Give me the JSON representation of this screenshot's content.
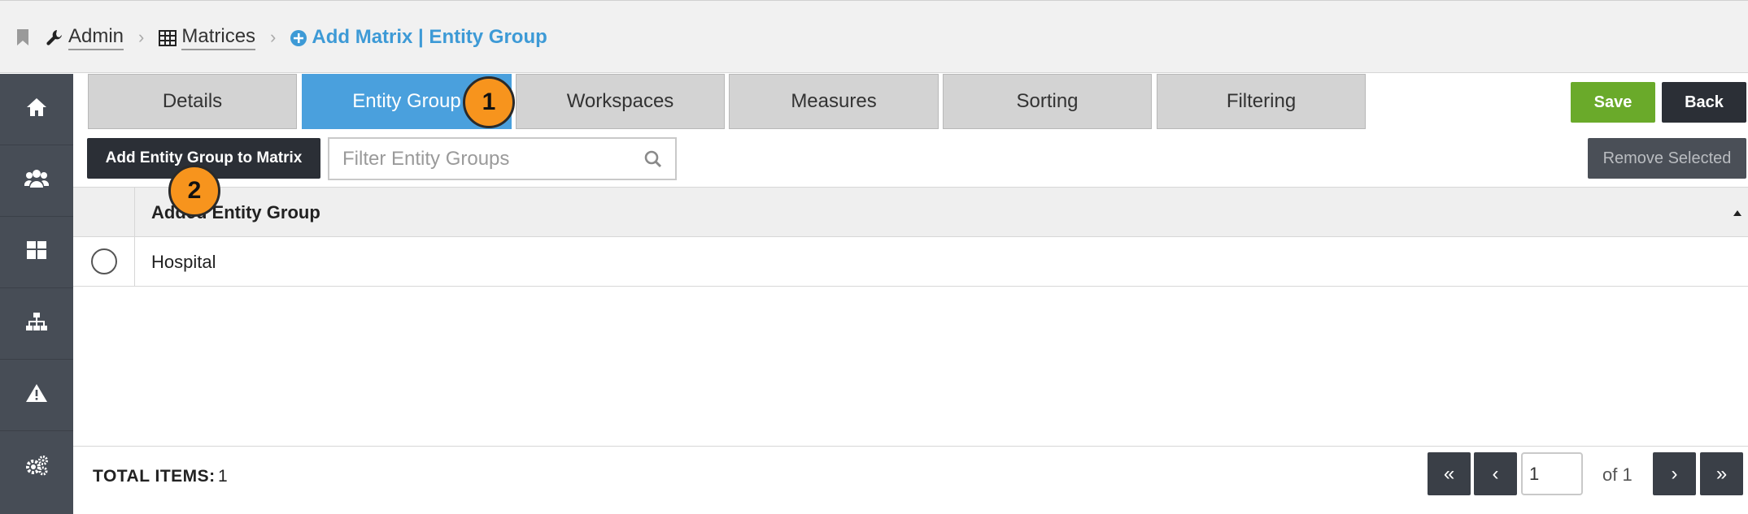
{
  "breadcrumb": {
    "admin": "Admin",
    "matrices": "Matrices",
    "current": "Add Matrix | Entity Group"
  },
  "tabs": [
    {
      "label": "Details"
    },
    {
      "label": "Entity Group"
    },
    {
      "label": "Workspaces"
    },
    {
      "label": "Measures"
    },
    {
      "label": "Sorting"
    },
    {
      "label": "Filtering"
    }
  ],
  "toolbar": {
    "save_label": "Save",
    "back_label": "Back",
    "add_label": "Add Entity Group to Matrix",
    "filter_placeholder": "Filter Entity Groups",
    "remove_label": "Remove Selected"
  },
  "table": {
    "header": "Added Entity Group",
    "rows": [
      {
        "name": "Hospital"
      }
    ]
  },
  "footer": {
    "total_label": "TOTAL ITEMS:",
    "total_value": "1",
    "page_value": "1",
    "of_label": "of 1"
  },
  "callouts": [
    "1",
    "2"
  ],
  "colors": {
    "accent": "#4aa0dd",
    "save": "#6aaa2a",
    "sidebar": "#474d56",
    "callout": "#f7941d"
  }
}
